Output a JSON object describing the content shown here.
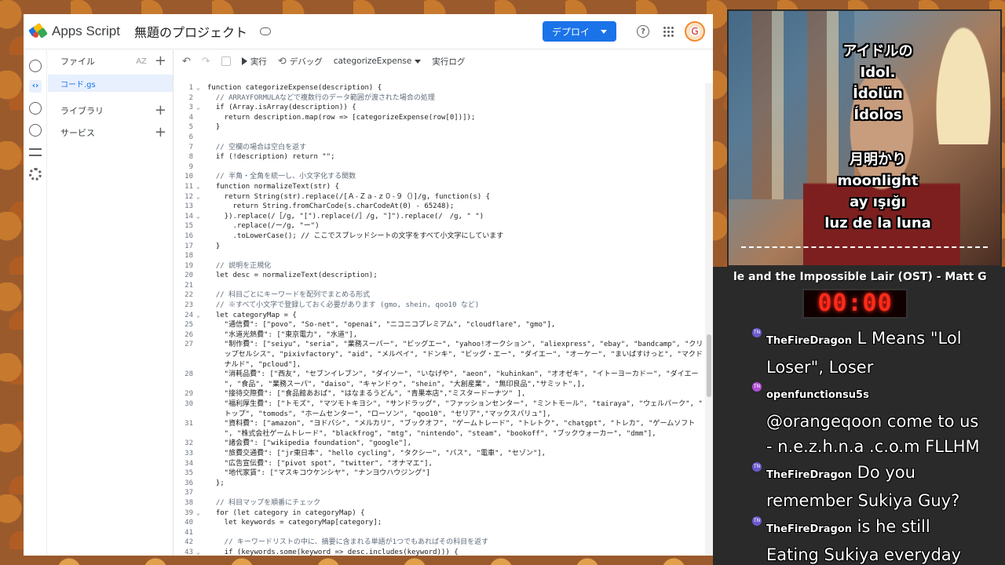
{
  "app": {
    "name": "Apps Script",
    "project_title": "無題のプロジェクト",
    "deploy_label": "デプロイ",
    "avatar_glyph": "G"
  },
  "files_panel": {
    "files_label": "ファイル",
    "file_name": "コード.gs",
    "libraries_label": "ライブラリ",
    "services_label": "サービス"
  },
  "toolbar": {
    "run_label": "実行",
    "debug_label": "デバッグ",
    "function_selected": "categorizeExpense",
    "log_label": "実行ログ"
  },
  "code": [
    {
      "n": "1",
      "f": "v",
      "t": "function categorizeExpense(description) {"
    },
    {
      "n": "2",
      "f": "",
      "t": "  // ARRAYFORMULAなどで複数行のデータ範囲が渡された場合の処理"
    },
    {
      "n": "3",
      "f": "v",
      "t": "  if (Array.isArray(description)) {"
    },
    {
      "n": "4",
      "f": "",
      "t": "    return description.map(row => [categorizeExpense(row[0])]);"
    },
    {
      "n": "5",
      "f": "",
      "t": "  }"
    },
    {
      "n": "6",
      "f": "",
      "t": ""
    },
    {
      "n": "7",
      "f": "",
      "t": "  // 空欄の場合は空白を返す"
    },
    {
      "n": "8",
      "f": "",
      "t": "  if (!description) return \"\";"
    },
    {
      "n": "9",
      "f": "",
      "t": ""
    },
    {
      "n": "10",
      "f": "",
      "t": "  // 半角・全角を統一し、小文字化する関数"
    },
    {
      "n": "11",
      "f": "v",
      "t": "  function normalizeText(str) {"
    },
    {
      "n": "12",
      "f": "v",
      "t": "    return String(str).replace(/[Ａ-Ｚａ-ｚ０-９（）]/g, function(s) {"
    },
    {
      "n": "13",
      "f": "",
      "t": "      return String.fromCharCode(s.charCodeAt(0) - 65248);"
    },
    {
      "n": "14",
      "f": "v",
      "t": "    }).replace(/［/g, \"[\").replace(/］/g, \"]\").replace(/　/g, \" \")"
    },
    {
      "n": "15",
      "f": "",
      "t": "      .replace(/ー/g, \"ー\")"
    },
    {
      "n": "16",
      "f": "",
      "t": "      .toLowerCase(); // ここでスプレッドシートの文字をすべて小文字にしています"
    },
    {
      "n": "17",
      "f": "",
      "t": "  }"
    },
    {
      "n": "18",
      "f": "",
      "t": ""
    },
    {
      "n": "19",
      "f": "",
      "t": "  // 説明を正規化"
    },
    {
      "n": "20",
      "f": "",
      "t": "  let desc = normalizeText(description);"
    },
    {
      "n": "21",
      "f": "",
      "t": ""
    },
    {
      "n": "22",
      "f": "",
      "t": "  // 科目ごとにキーワードを配列でまとめる形式"
    },
    {
      "n": "23",
      "f": "",
      "t": "  // ※すべて小文字で登録しておく必要があります (gmo, shein, qoo10 など)"
    },
    {
      "n": "24",
      "f": "v",
      "t": "  let categoryMap = {"
    },
    {
      "n": "25",
      "f": "",
      "t": "    \"通信費\": [\"povo\", \"So-net\", \"openai\", \"ニコニコプレミアム\", \"cloudflare\", \"gmo\"],"
    },
    {
      "n": "26",
      "f": "",
      "t": "    \"水道光熱費\": [\"東京電力\", \"水道\"],"
    },
    {
      "n": "27",
      "f": "",
      "t": "    \"制作費\": [\"seiyu\", \"seria\", \"業務スーパー\", \"ビッグエー\", \"yahoo!オークション\", \"aliexpress\", \"ebay\", \"bandcamp\", \"クリ"
    },
    {
      "n": "",
      "f": "",
      "t": "    ップセルシス\", \"pixivfactory\", \"aid\", \"メルペイ\", \"ドンキ\", \"ビッグ・エー\", \"ダイエー\", \"オーケー\", \"まいばすけっと\", \"マクド"
    },
    {
      "n": "",
      "f": "",
      "t": "    ナルド\", \"pcloud\"],"
    },
    {
      "n": "28",
      "f": "",
      "t": "    \"消耗品費\": [\"西友\", \"セブンイレブン\", \"ダイソー\", \"いなげや\", \"aeon\", \"kuhinkan\", \"オオゼキ\", \"イトーヨーカドー\", \"ダイエー"
    },
    {
      "n": "",
      "f": "",
      "t": "    \", \"食品\", \"業務スーパ\", \"daiso\", \"キャンドゥ\", \"shein\", \"大創産業\", \"無印良品\",\"サミット\",],"
    },
    {
      "n": "29",
      "f": "",
      "t": "    \"接待交際費\": [\"食品館あおば\", \"はなまるうどん\", \"青果本店\",\"ミスタードーナツ\" ],"
    },
    {
      "n": "30",
      "f": "",
      "t": "    \"福利厚生費\": [\"トモズ\", \"マツモトキヨシ\", \"サンドラッグ\", \"ファッションセンター\", \"ミントモール\", \"tairaya\", \"ウェルパーク\", \""
    },
    {
      "n": "",
      "f": "",
      "t": "    トップ\", \"tomods\", \"ホームセンター\", \"ローソン\", \"qoo10\", \"セリア\",\"マックスバリュ\"],"
    },
    {
      "n": "31",
      "f": "",
      "t": "    \"資料費\": [\"amazon\", \"ヨドバシ\", \"メルカリ\", \"ブックオフ\", \"ゲームトレード\", \"トレトク\", \"chatgpt\", \"トレカ\", \"ゲームソフト"
    },
    {
      "n": "",
      "f": "",
      "t": "    \", \"株式会社ゲームトレード\", \"blackfrog\", \"mtg\", \"nintendo\", \"steam\", \"bookoff\", \"ブックウォーカー\", \"dmm\"],"
    },
    {
      "n": "32",
      "f": "",
      "t": "    \"諸会費\": [\"wikipedia foundation\", \"google\"],"
    },
    {
      "n": "33",
      "f": "",
      "t": "    \"旅費交通費\": [\"jr東日本\", \"hello cycling\", \"タクシー\", \"バス\", \"電車\", \"セゾン\"],"
    },
    {
      "n": "34",
      "f": "",
      "t": "    \"広告宣伝費\": [\"pivot spot\", \"twitter\", \"オナマエ\"],"
    },
    {
      "n": "35",
      "f": "",
      "t": "    \"地代家賃\": [\"マスキコウケンシヤ\", \"ナンヨウハウジング\"]"
    },
    {
      "n": "36",
      "f": "",
      "t": "  };"
    },
    {
      "n": "37",
      "f": "",
      "t": ""
    },
    {
      "n": "38",
      "f": "",
      "t": "  // 科目マップを順番にチェック"
    },
    {
      "n": "39",
      "f": "v",
      "t": "  for (let category in categoryMap) {"
    },
    {
      "n": "40",
      "f": "",
      "t": "    let keywords = categoryMap[category];"
    },
    {
      "n": "41",
      "f": "",
      "t": ""
    },
    {
      "n": "42",
      "f": "",
      "t": "    // キーワードリストの中に、摘要に含まれる単語が1つでもあればその科目を返す"
    },
    {
      "n": "43",
      "f": "v",
      "t": "    if (keywords.some(keyword => desc.includes(keyword))) {"
    }
  ],
  "webcam": {
    "caption_top": [
      "アイドルの",
      "Idol.",
      "İdolün",
      "Ídolos"
    ],
    "caption_bottom": [
      "月明かり",
      "moonlight",
      "ay ışığı",
      "luz de la luna"
    ]
  },
  "overlay": {
    "now_playing": "le and the Impossible Lair (OST) - Matt G",
    "timer": "00:00"
  },
  "chat": [
    {
      "user": "TheFireDragon",
      "badge": "TN",
      "text": "L Means \"Lol Loser\", Loser"
    },
    {
      "user": "openfunctionsu5s",
      "badge": "TN",
      "text": "@orangeqoon come to us - n.e.z.h.n.a .c.o.m FLLHM"
    },
    {
      "user": "TheFireDragon",
      "badge": "TN",
      "text": "Do you remember Sukiya Guy?"
    },
    {
      "user": "TheFireDragon",
      "badge": "TN",
      "text": "is he still Eating Sukiya everyday"
    }
  ],
  "colors": {
    "accent": "#1a73e8",
    "timer": "#ff2a1a",
    "selected_file_bg": "#e8f0fe"
  }
}
